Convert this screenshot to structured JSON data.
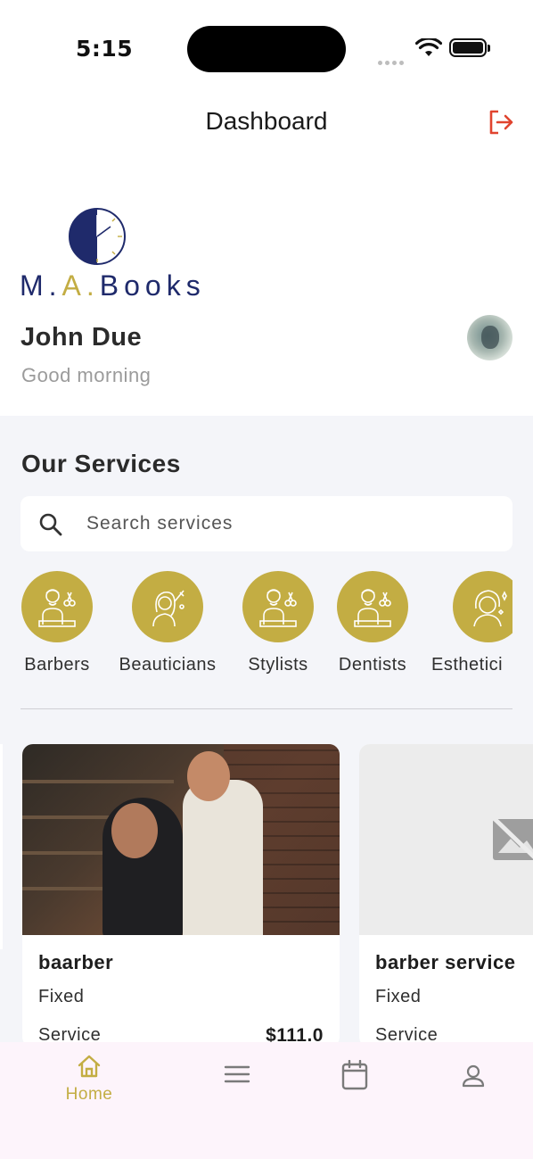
{
  "status_bar": {
    "time": "5:15"
  },
  "header": {
    "title": "Dashboard",
    "logout_icon": "logout-icon"
  },
  "brand": {
    "logo_text_prefix": "M.",
    "logo_text_accent": "A.",
    "logo_text_suffix": "Books"
  },
  "user": {
    "name": "John Due",
    "greeting": "Good morning"
  },
  "services": {
    "title": "Our Services",
    "search": {
      "placeholder": "Search services",
      "value": ""
    },
    "categories": [
      {
        "label": "Barbers",
        "icon": "barber-icon"
      },
      {
        "label": "Beauticians",
        "icon": "beautician-icon"
      },
      {
        "label": "Stylists",
        "icon": "stylist-icon"
      },
      {
        "label": "Dentists",
        "icon": "dentist-icon"
      },
      {
        "label": "Esthetici",
        "icon": "esthetician-icon"
      }
    ],
    "cards": [
      {
        "title": "baarber",
        "type": "Fixed",
        "label": "Service",
        "price": "$111.0"
      },
      {
        "title": "barber service",
        "type": "Fixed",
        "label": "Service",
        "price": ""
      }
    ]
  },
  "bottom_nav": {
    "items": [
      {
        "label": "Home",
        "icon": "home-icon",
        "active": true
      },
      {
        "label": "",
        "icon": "menu-icon",
        "active": false
      },
      {
        "label": "",
        "icon": "calendar-icon",
        "active": false
      },
      {
        "label": "",
        "icon": "profile-icon",
        "active": false
      }
    ]
  },
  "colors": {
    "accent": "#c3ad43",
    "logout": "#e0442f",
    "brand_navy": "#1f2a6b",
    "nav_bg": "#fdf4fb",
    "section_bg": "#f4f5f9"
  }
}
